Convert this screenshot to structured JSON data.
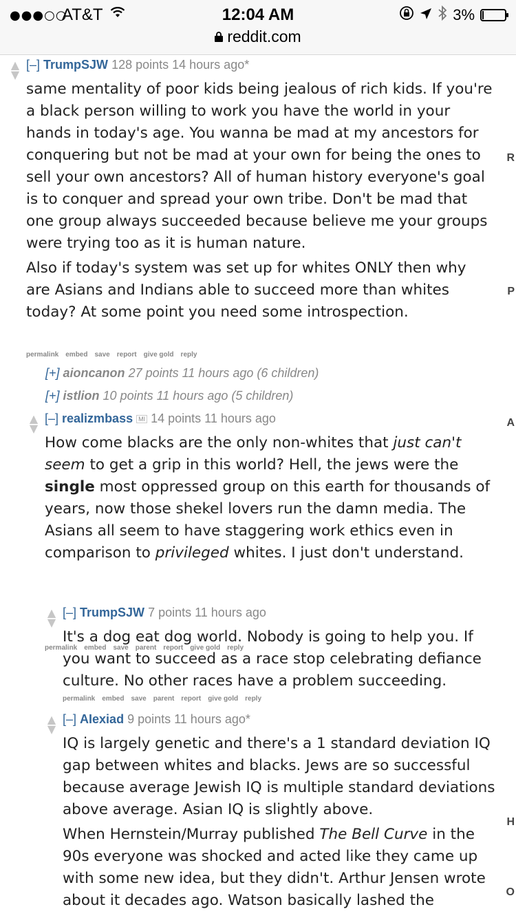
{
  "status": {
    "signal": "●●●○○",
    "carrier": "AT&T",
    "time": "12:04 AM",
    "battery": "3%",
    "battery_level": 0.03,
    "url": "reddit.com"
  },
  "comments": [
    {
      "expand": "[–]",
      "author": "TrumpSJW",
      "meta": "128 points 14 hours ago*",
      "paragraphs": [
        "same mentality of poor kids being jealous of rich kids. If you're a black person willing to work you have the world in your hands in today's age. You wanna be mad at my ancestors for conquering but not be mad at your own for being the ones to sell your own ancestors? All of human history everyone's goal is to conquer and spread your own tribe. Don't be mad that one group always succeeded because believe me your groups were trying too as it is human nature.",
        "Also if today's system was set up for whites ONLY then why are Asians and Indians able to succeed more than whites today? At some point you need some introspection."
      ],
      "buttons": [
        "permalink",
        "embed",
        "save",
        "report",
        "give gold",
        "reply"
      ]
    },
    {
      "expand": "[+]",
      "author": "aioncanon",
      "meta": "27 points 11 hours ago (6 children)"
    },
    {
      "expand": "[+]",
      "author": "istlion",
      "meta": "10 points 11 hours ago (5 children)"
    },
    {
      "expand": "[–]",
      "author": "realizmbass",
      "flair": "MI",
      "meta": "14 points 11 hours ago",
      "p1_a": "How come blacks are the only non-whites that ",
      "p1_em": "just can't seem",
      "p1_b": " to get a grip in this world? Hell, the jews were the ",
      "p1_strong": "single",
      "p1_c": " most oppressed group on this earth for thousands of years, now those shekel lovers run the damn media. The Asians all seem to have staggering work ethics even in comparison to ",
      "p1_em2": "privileged",
      "p1_d": " whites. I just don't understand.",
      "buttons": [
        "permalink",
        "embed",
        "save",
        "parent",
        "report",
        "give gold",
        "reply"
      ]
    },
    {
      "expand": "[–]",
      "author": "TrumpSJW",
      "meta": "7 points 11 hours ago",
      "paragraphs": [
        "It's a dog eat dog world. Nobody is going to help you. If you want to succeed as a race stop celebrating defiance culture. No other races have a problem succeeding."
      ],
      "buttons": [
        "permalink",
        "embed",
        "save",
        "parent",
        "report",
        "give gold",
        "reply"
      ]
    },
    {
      "expand": "[–]",
      "author": "AIexiad",
      "meta": "9 points 11 hours ago*",
      "p1": "IQ is largely genetic and there's a 1 standard deviation IQ gap between whites and blacks. Jews are so successful because average Jewish IQ is multiple standard deviations above average. Asian IQ is slightly above.",
      "p2_a": "When Hernstein/Murray published ",
      "p2_em": "The Bell Curve",
      "p2_b": " in the 90s everyone was shocked and acted like they came up with some new idea, but they didn't. Arthur Jensen wrote about it decades ago. Watson basically lashed the"
    }
  ],
  "sidebar_letters": [
    "R",
    "P",
    "A",
    "H",
    "O"
  ]
}
